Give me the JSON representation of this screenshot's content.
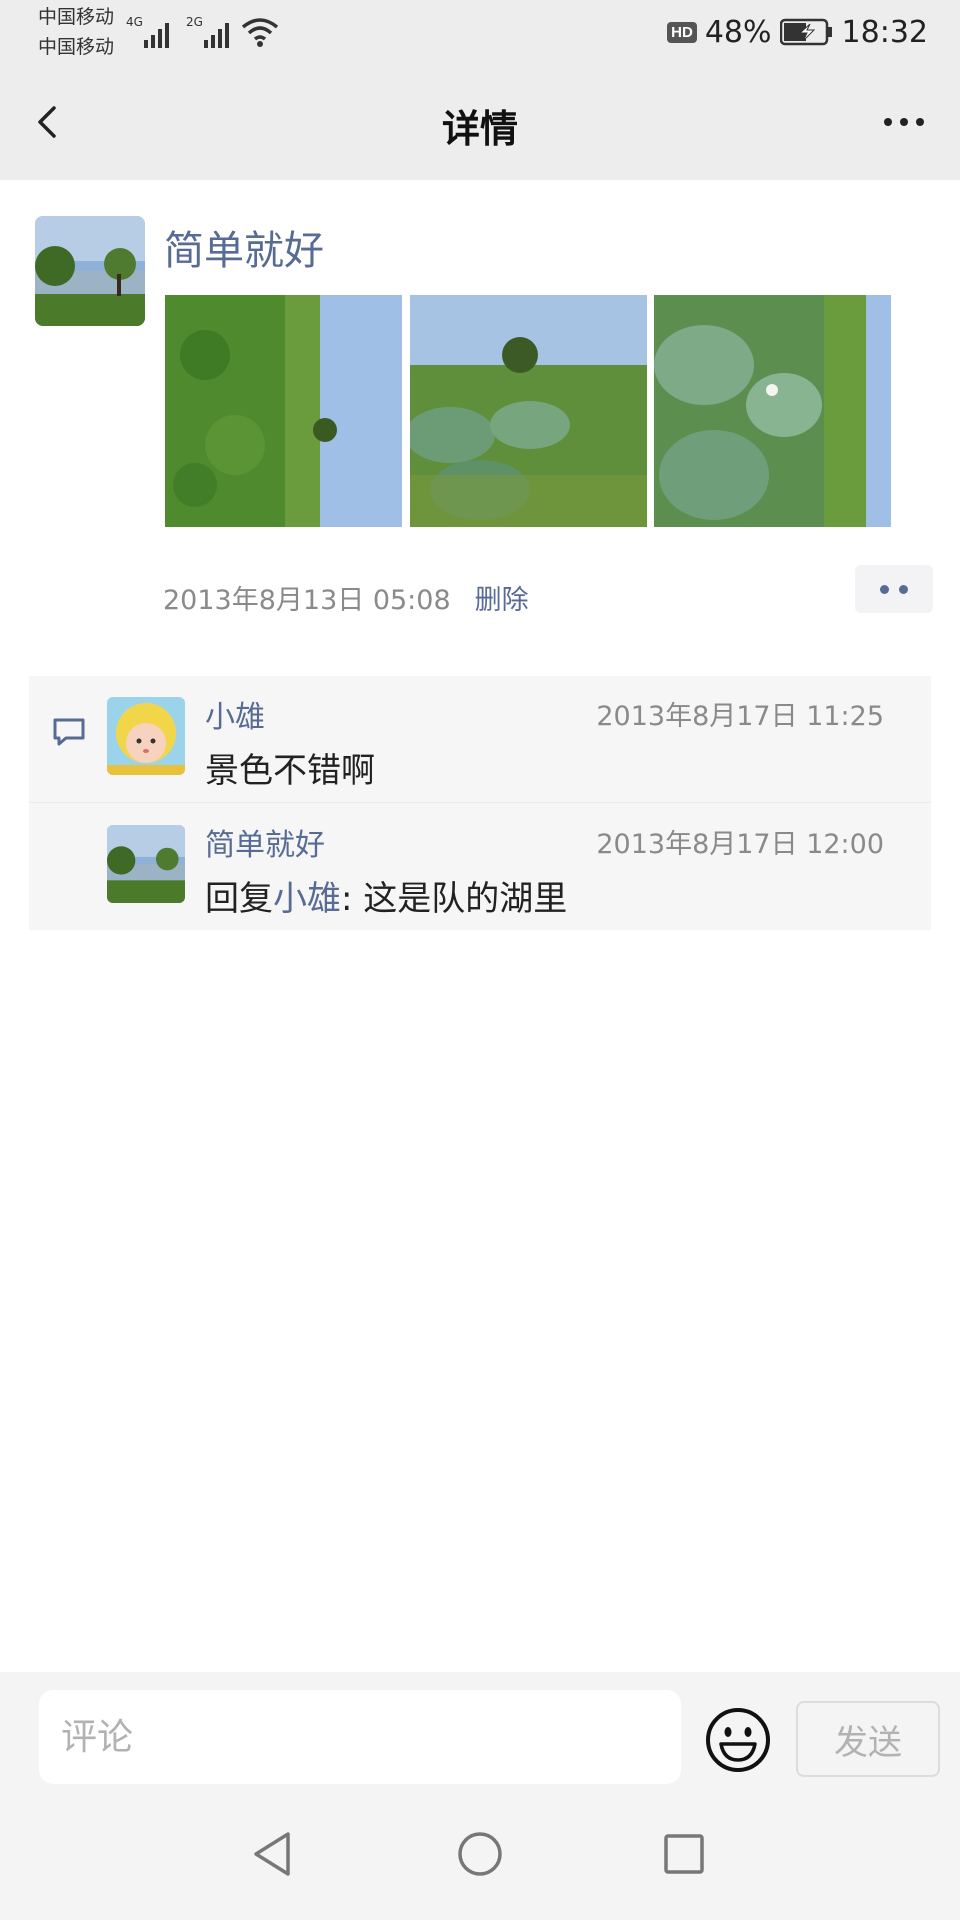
{
  "status_bar": {
    "carrier1": "中国移动",
    "carrier2": "中国移动",
    "net1": "4G",
    "net2": "2G",
    "hd": "HD",
    "battery": "48%",
    "time": "18:32"
  },
  "nav": {
    "title": "详情",
    "back_icon": "chevron-left-icon",
    "more_icon": "more-dots-icon"
  },
  "post": {
    "author": "简单就好",
    "timestamp": "2013年8月13日 05:08",
    "delete_label": "删除",
    "photos": [
      "lotus-field-photo",
      "lotus-pond-photo",
      "lotus-leaves-photo"
    ]
  },
  "comments": [
    {
      "author": "小雄",
      "time": "2013年8月17日 11:25",
      "text": "景色不错啊"
    },
    {
      "author": "简单就好",
      "time": "2013年8月17日 12:00",
      "reply_prefix": "回复",
      "reply_to": "小雄",
      "reply_sep": ":",
      "text": " 这是队的湖里"
    }
  ],
  "input_bar": {
    "placeholder": "评论",
    "send_label": "发送",
    "emoji_icon": "smiley-icon"
  },
  "colors": {
    "link": "#576b95",
    "topbar_bg": "#ededed",
    "comment_bg": "#f6f6f6"
  }
}
